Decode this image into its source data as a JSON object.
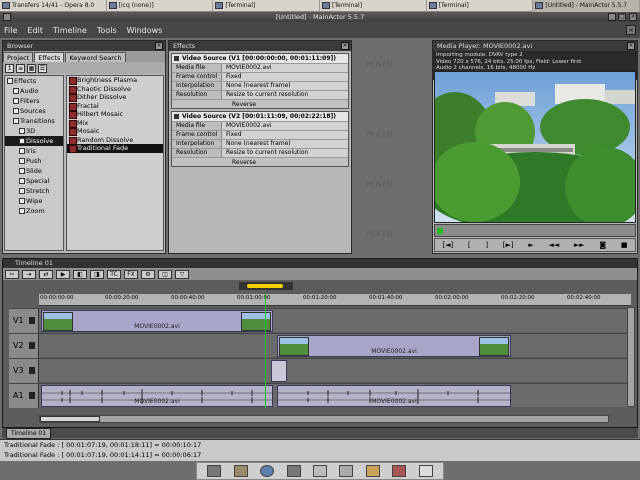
{
  "taskbar": {
    "tasks": [
      {
        "label": "Transfers 14/41 - Opera 8.0"
      },
      {
        "label": "[icq (none)]"
      },
      {
        "label": "[Terminal]"
      },
      {
        "label": "[Terminal]"
      },
      {
        "label": "[Terminal]"
      },
      {
        "label": "[Untitled] - MainActor 5.5.7"
      }
    ]
  },
  "window": {
    "title": "[Untitled] - MainActor 5.5.7"
  },
  "menu": {
    "items": [
      "File",
      "Edit",
      "Timeline",
      "Tools",
      "Windows"
    ]
  },
  "browser": {
    "title": "Browser",
    "tabs": [
      "Project",
      "Effects",
      "Keyword Search"
    ],
    "tree": [
      {
        "label": "Effects",
        "indent": 0
      },
      {
        "label": "Audio",
        "indent": 1
      },
      {
        "label": "Filters",
        "indent": 1
      },
      {
        "label": "Sources",
        "indent": 1
      },
      {
        "label": "Transitions",
        "indent": 1
      },
      {
        "label": "3D",
        "indent": 2
      },
      {
        "label": "Dissolve",
        "indent": 2,
        "selected": true
      },
      {
        "label": "Iris",
        "indent": 2
      },
      {
        "label": "Push",
        "indent": 2
      },
      {
        "label": "Slide",
        "indent": 2
      },
      {
        "label": "Special",
        "indent": 2
      },
      {
        "label": "Stretch",
        "indent": 2
      },
      {
        "label": "Wipe",
        "indent": 2
      },
      {
        "label": "Zoom",
        "indent": 2
      }
    ],
    "effects": [
      {
        "label": "Brightness Plasma"
      },
      {
        "label": "Chaotic Dissolve"
      },
      {
        "label": "Dither Dissolve"
      },
      {
        "label": "Fractal"
      },
      {
        "label": "Hilbert Mosaic"
      },
      {
        "label": "Mix"
      },
      {
        "label": "Mosaic"
      },
      {
        "label": "Random Dissolve"
      },
      {
        "label": "Traditional Fade",
        "selected": true
      }
    ]
  },
  "effects_panel": {
    "title": "Effects",
    "sources": [
      {
        "header": "Video Source (V1 [00:00:00:00, 00:01:11:09])",
        "rows": [
          {
            "k": "Media file",
            "v": "MOVIE0002.avi"
          },
          {
            "k": "Frame control",
            "v": "Fixed"
          },
          {
            "k": "Interpolation",
            "v": "None (nearest frame)"
          },
          {
            "k": "Resolution",
            "v": "Resize to current resolution"
          }
        ],
        "reverse": "Reverse"
      },
      {
        "header": "Video Source (V2 [00:01:11:09, 00:02:22:18])",
        "rows": [
          {
            "k": "Media file",
            "v": "MOVIE0002.avi"
          },
          {
            "k": "Frame control",
            "v": "Fixed"
          },
          {
            "k": "Interpolation",
            "v": "None (nearest frame)"
          },
          {
            "k": "Resolution",
            "v": "Resize to current resolution"
          }
        ],
        "reverse": "Reverse"
      }
    ],
    "watermark": "MAIN"
  },
  "player": {
    "title": "Media Player: MOVIE0002.avi",
    "info": [
      "Importing module: DVAV type 2",
      "Video 720 x 576, 24 bits, 25.00 fps, Field: Lower first",
      "Audio 2 channels, 16 bits, 48000 Hz"
    ],
    "controls": [
      "[◄]",
      "[",
      "]",
      "[►]",
      "►",
      "◄◄",
      "►►",
      "◙",
      "■"
    ]
  },
  "timeline": {
    "title": "Timeline 01",
    "tab": "Timeline 01",
    "ruler": [
      "00:00:00:00",
      "00:00:20:00",
      "00:00:40:00",
      "00:01:00:00",
      "00:01:20:00",
      "00:01:40:00",
      "00:02:00:00",
      "00:02:20:00",
      "00:02:40:00"
    ],
    "tracks": [
      {
        "label": "V1",
        "clip": "MOVIE0002.avi"
      },
      {
        "label": "V2",
        "clip": "MOVIE0002.avi"
      },
      {
        "label": "V3",
        "clip": ""
      },
      {
        "label": "A1",
        "clips": [
          "MOVIE0002.avi",
          "MOVIE0002.avi"
        ]
      }
    ]
  },
  "status": {
    "lines": [
      "Traditional Fade : [ 00:01:07:19, 00:01:18:11] = 00:00:10:17",
      "Traditional Fade : [ 00:01:07:19, 00:01:14:11] = 00:00:06:17"
    ]
  }
}
